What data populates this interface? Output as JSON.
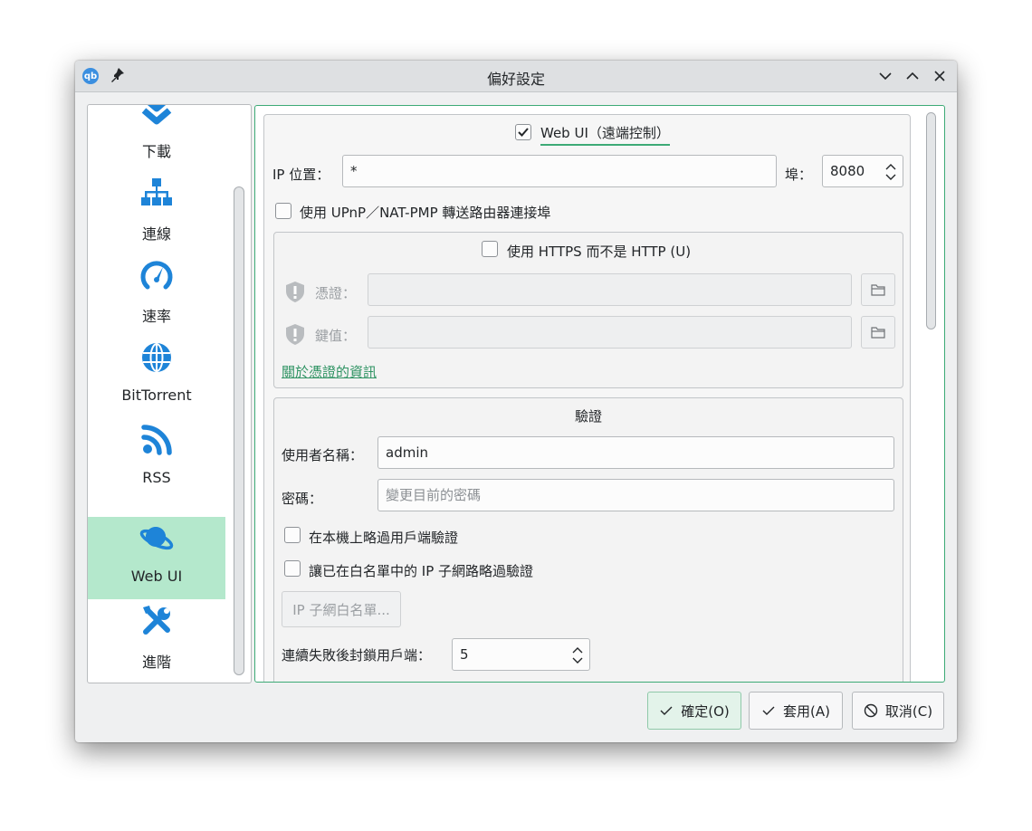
{
  "window": {
    "title": "偏好設定",
    "app_icon_text": "qb"
  },
  "sidebar": {
    "items": [
      {
        "label": "下載",
        "icon": "chevron-double-down-icon"
      },
      {
        "label": "連線",
        "icon": "network-icon"
      },
      {
        "label": "速率",
        "icon": "speedometer-icon"
      },
      {
        "label": "BitTorrent",
        "icon": "globe-icon"
      },
      {
        "label": "RSS",
        "icon": "rss-icon"
      },
      {
        "label": "Web UI",
        "icon": "planet-icon",
        "active": true
      },
      {
        "label": "進階",
        "icon": "tools-icon"
      }
    ]
  },
  "webui": {
    "enable_label": "Web UI（遠端控制）",
    "enable_checked": true,
    "ip_label": "IP 位置：",
    "ip_value": "*",
    "port_label": "埠：",
    "port_value": "8080",
    "upnp_label": "使用 UPnP／NAT-PMP 轉送路由器連接埠",
    "upnp_checked": false
  },
  "https": {
    "label": "使用 HTTPS 而不是 HTTP (U)",
    "checked": false,
    "cert_label": "憑證：",
    "key_label": "鍵值：",
    "info_link": "關於憑證的資訊"
  },
  "auth": {
    "title": "驗證",
    "username_label": "使用者名稱：",
    "username_value": "admin",
    "password_label": "密碼：",
    "password_placeholder": "變更目前的密碼",
    "bypass_local_label": "在本機上略過用戶端驗證",
    "bypass_local_checked": false,
    "bypass_whitelist_label": "讓已在白名單中的 IP 子網路略過驗證",
    "bypass_whitelist_checked": false,
    "whitelist_button": "IP 子網白名單...",
    "ban_label": "連續失敗後封鎖用戶端：",
    "ban_value": "5"
  },
  "footer": {
    "ok": "確定(O)",
    "apply": "套用(A)",
    "cancel": "取消(C)"
  },
  "colors": {
    "accent": "#3daa76",
    "sidebar_active": "#b4e8cc",
    "icon_blue": "#1e84d8"
  }
}
